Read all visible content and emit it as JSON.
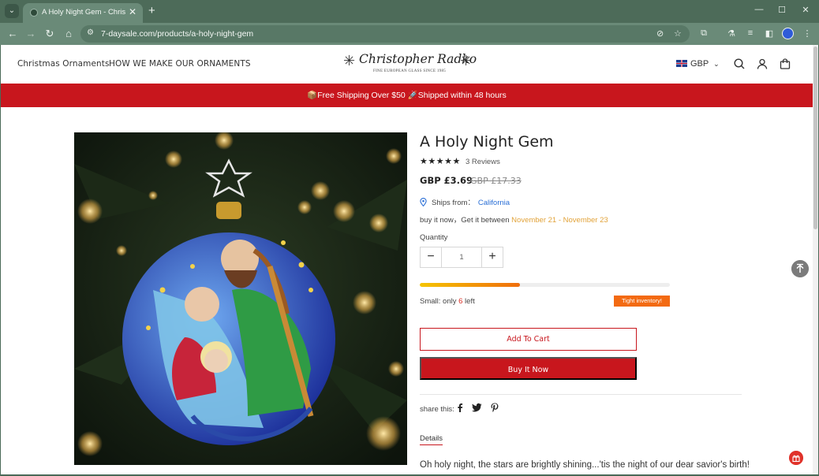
{
  "browser": {
    "tab_title": "A Holy Night Gem - Christopher Radko",
    "tab_close": "✕",
    "new_tab": "+",
    "url": "7-daysale.com/products/a-holy-night-gem",
    "window_controls": [
      "—",
      "☐",
      "✕"
    ]
  },
  "header": {
    "nav": [
      "Christmas Ornaments",
      "HOW WE MAKE OUR ORNAMENTS"
    ],
    "logo_text": "Christopher Radko",
    "logo_tagline": "FINE EUROPEAN GLASS SINCE 1985",
    "currency": "GBP",
    "icons": [
      "search-icon",
      "account-icon",
      "cart-icon"
    ]
  },
  "promo": {
    "text": "📦Free Shipping Over $50  🚀Shipped within 48 hours"
  },
  "product": {
    "title": "A Holy Night Gem",
    "stars": "★★★★★",
    "rating": 5,
    "reviews": "3 Reviews",
    "price": "GBP £3.69",
    "old_price": "GBP £17.33",
    "ships_from_label": "Ships from：",
    "ships_from": "California",
    "delivery_prefix": "buy it now，Get it between ",
    "delivery_dates": "November 21 - November 23",
    "quantity_label": "Quantity",
    "quantity": "1",
    "qty_minus": "−",
    "qty_plus": "+",
    "stock_prefix": "Small: only ",
    "stock_count": "6",
    "stock_suffix": " left",
    "stock_level": 0.4,
    "stock_badge": "Tight inventory!",
    "add_to_cart": "Add To Cart",
    "buy_now": "Buy It Now",
    "share_label": "share this:",
    "share_icons": [
      "facebook-icon",
      "twitter-icon",
      "pinterest-icon"
    ],
    "details_tab": "Details",
    "description": "Oh holy night, the stars are brightly shining...'tis the night of our dear savior's birth!"
  },
  "colors": {
    "brand_red": "#c8161d",
    "chrome_green": "#6a8a78",
    "link_blue": "#2a6fd6",
    "date_orange": "#e2a33a",
    "badge_orange": "#f36a12"
  }
}
